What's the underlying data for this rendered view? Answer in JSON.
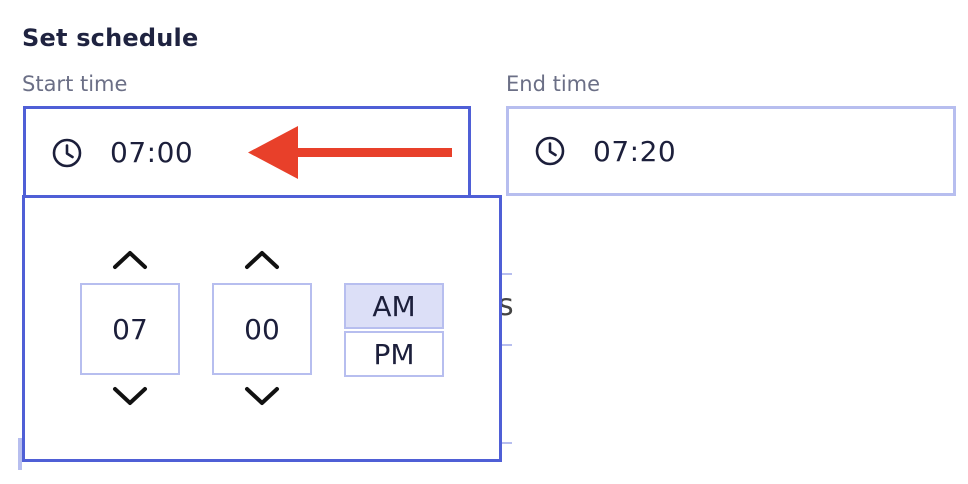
{
  "schedule": {
    "heading": "Set schedule",
    "start": {
      "label": "Start time",
      "value": "07:00",
      "icon": "clock-icon"
    },
    "end": {
      "label": "End time",
      "value": "07:20",
      "icon": "clock-icon"
    }
  },
  "picker": {
    "hour": "07",
    "minute": "00",
    "am_label": "AM",
    "pm_label": "PM",
    "selected_period": "AM"
  },
  "background": {
    "partial_char": "s"
  },
  "colors": {
    "accent": "#4f5fd6",
    "border_light": "#b7beef",
    "selected_fill": "#dcdff7",
    "arrow": "#e8402a"
  }
}
